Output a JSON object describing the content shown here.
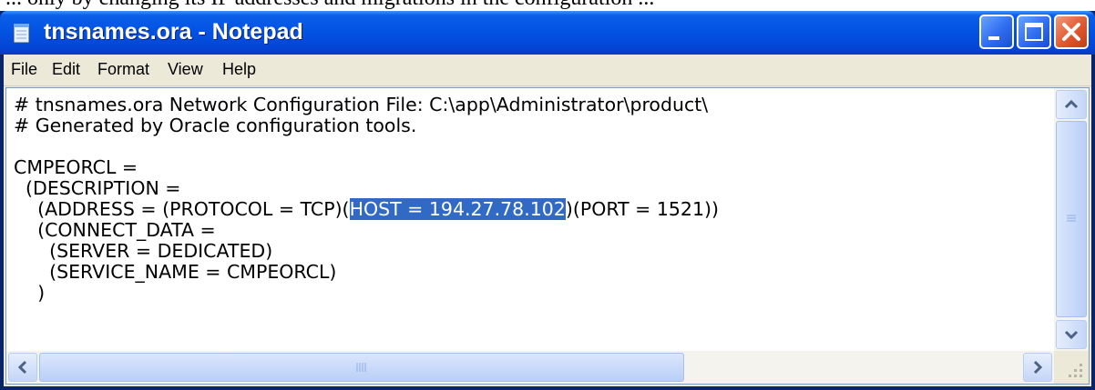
{
  "page_top_text": "... only by changing its IP addresses and migrations in the configuration ...",
  "window": {
    "title": "tnsnames.ora - Notepad"
  },
  "menu": {
    "file": "File",
    "edit": "Edit",
    "format": "Format",
    "view": "View",
    "help": "Help"
  },
  "editor": {
    "line1": "# tnsnames.ora Network Configuration File: C:\\app\\Administrator\\product\\",
    "line2": "# Generated by Oracle configuration tools.",
    "line3": "",
    "line4": "CMPEORCL =",
    "line5": "  (DESCRIPTION =",
    "line6_before": "    (ADDRESS = (PROTOCOL = TCP)(",
    "line6_selected": "HOST = 194.27.78.102",
    "line6_after": ")(PORT = 1521))",
    "line7": "    (CONNECT_DATA =",
    "line8": "      (SERVER = DEDICATED)",
    "line9": "      (SERVICE_NAME = CMPEORCL)",
    "line10": "    )"
  },
  "icons": {
    "app": "notepad-icon",
    "minimize": "minimize-icon",
    "maximize": "maximize-icon",
    "close": "close-icon",
    "scroll_up": "chevron-up-icon",
    "scroll_down": "chevron-down-icon",
    "scroll_left": "chevron-left-icon",
    "scroll_right": "chevron-right-icon"
  },
  "colors": {
    "title_bar": "#0353e3",
    "selection": "#316ac5",
    "close_button": "#e2582f"
  }
}
